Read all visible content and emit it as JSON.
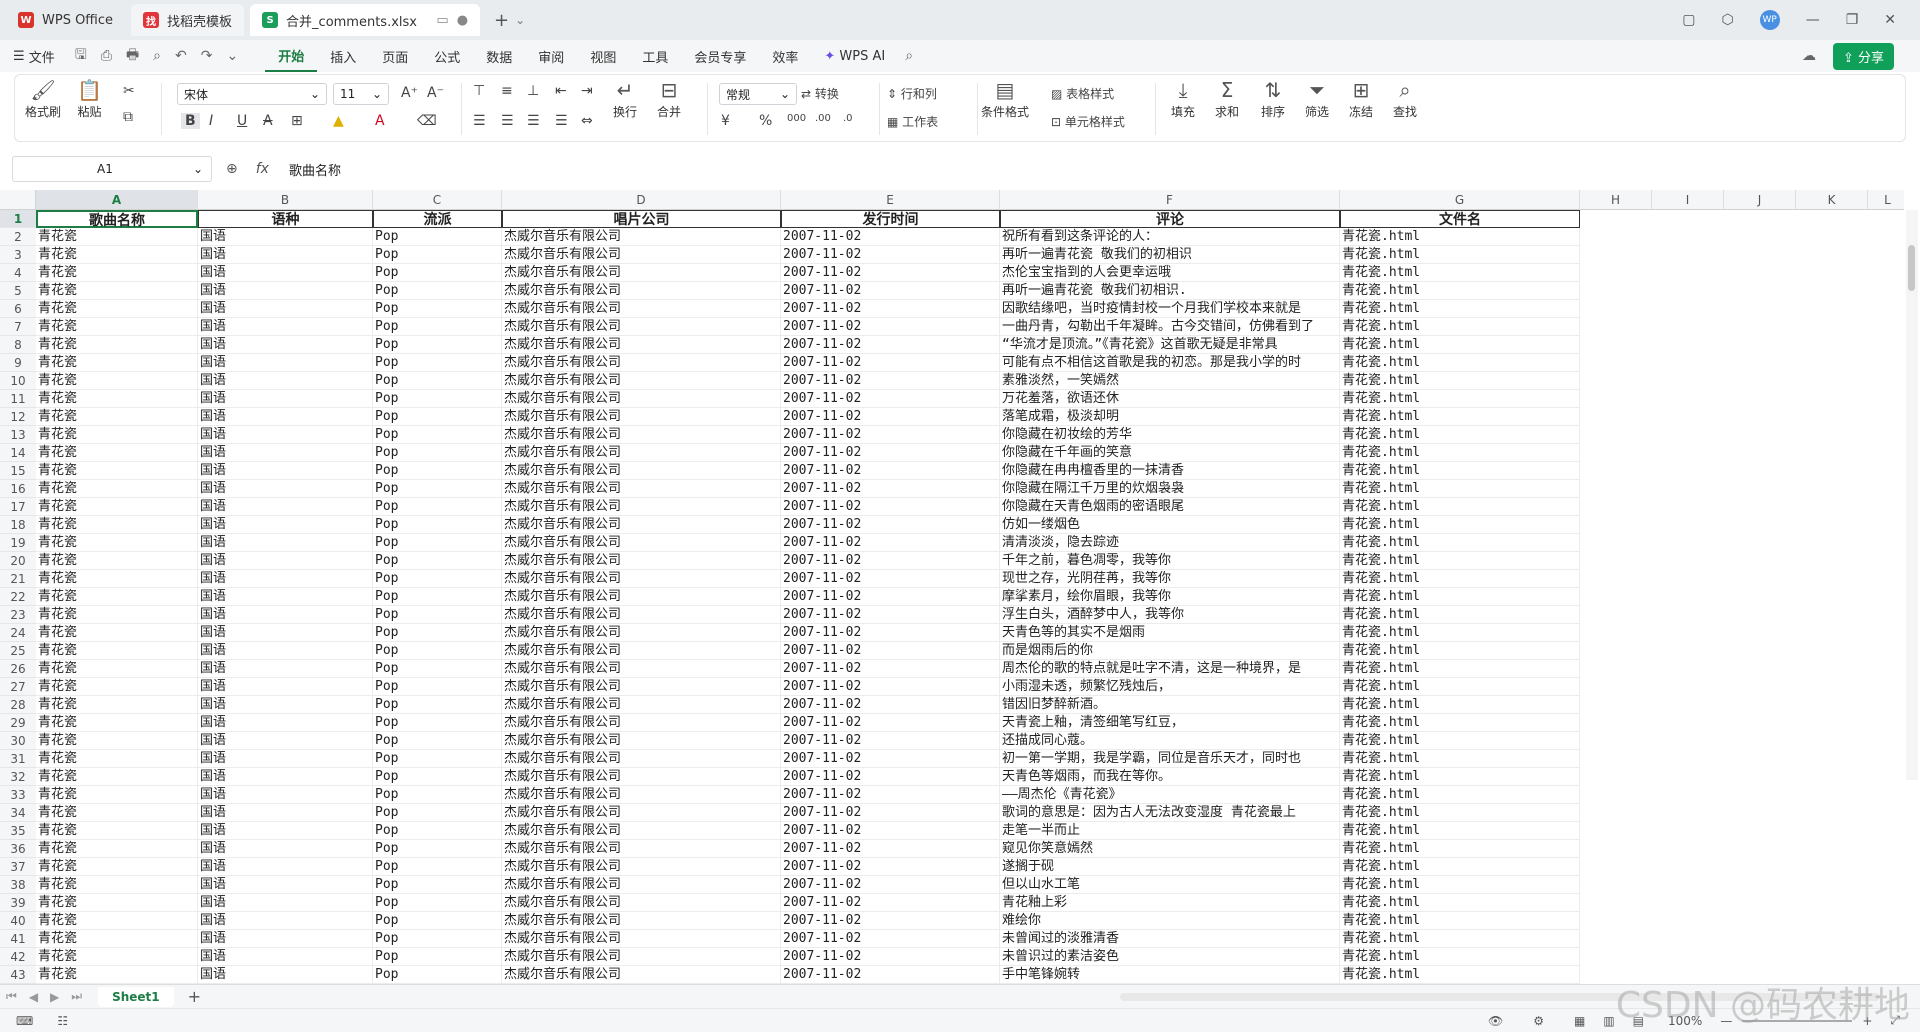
{
  "window": {
    "tabs": [
      {
        "label": "WPS Office",
        "icon": "wps-logo"
      },
      {
        "label": "找稻壳模板",
        "icon": "template-icon"
      },
      {
        "label": "合并_comments.xlsx",
        "icon": "sheet-icon"
      }
    ],
    "new_tab_label": "+",
    "avatar_text": "WP"
  },
  "menu": {
    "file_label": "文件",
    "items": [
      "开始",
      "插入",
      "页面",
      "公式",
      "数据",
      "审阅",
      "视图",
      "工具",
      "会员专享",
      "效率"
    ],
    "ai_label": "WPS AI",
    "share_label": "分享"
  },
  "ribbon": {
    "format_painter": "格式刷",
    "paste": "粘贴",
    "font_name": "宋体",
    "font_size": "11",
    "wrap": "换行",
    "merge": "合并",
    "number_format": "常规",
    "convert": "转换",
    "row_col": "行和列",
    "worksheet": "工作表",
    "cond_format": "条件格式",
    "table_style": "表格样式",
    "cell_style": "单元格样式",
    "fill": "填充",
    "sum": "求和",
    "sort": "排序",
    "filter": "筛选",
    "freeze": "冻结",
    "find": "查找"
  },
  "formula": {
    "cell_ref": "A1",
    "fx": "fx",
    "content": "歌曲名称"
  },
  "sheet": {
    "columns": [
      "A",
      "B",
      "C",
      "D",
      "E",
      "F",
      "G",
      "H",
      "I",
      "J",
      "K",
      "L"
    ],
    "headers": [
      "歌曲名称",
      "语种",
      "流派",
      "唱片公司",
      "发行时间",
      "评论",
      "文件名"
    ],
    "song": "青花瓷",
    "lang": "国语",
    "genre": "Pop",
    "company": "杰威尔音乐有限公司",
    "date": "2007-11-02",
    "file": "青花瓷.html",
    "comments": [
      "祝所有看到这条评论的人：",
      "再听一遍青花瓷 敬我们的初相识",
      "杰伦宝宝指到的人会更幸运哦",
      "再听一遍青花瓷 敬我们初相识.",
      "因歌结缘吧，当时疫情封校一个月我们学校本来就是",
      "一曲丹青，勾勒出千年凝眸。古今交错间，仿佛看到了",
      "“华流才是顶流。”《青花瓷》这首歌无疑是非常具",
      "可能有点不相信这首歌是我的初恋。那是我小学的时",
      "素雅淡然，一笑嫣然",
      "万花羞落，欲语还休",
      "落笔成霜，极淡却明",
      "你隐藏在初妆绘的芳华",
      "你隐藏在千年画的笑意",
      "你隐藏在冉冉檀香里的一抹清香",
      "你隐藏在隔江千万里的炊烟袅袅",
      "你隐藏在天青色烟雨的密语眼尾",
      "仿如一缕烟色",
      "清清淡淡，隐去踪迹",
      "千年之前，暮色凋零，我等你",
      "现世之存，光阴荏苒，我等你",
      "摩挲素月，绘你眉眼，我等你",
      "浮生白头，酒醉梦中人，我等你",
      "天青色等的其实不是烟雨",
      "而是烟雨后的你",
      "周杰伦的歌的特点就是吐字不清，这是一种境界，是",
      "小雨湿未透，频繁忆残烛后，",
      "错因旧梦醉新酒。",
      "天青瓷上釉，清签细笔写红豆，",
      "还描成同心蔻。",
      "初一第一学期，我是学霸，同位是音乐天才，同时也",
      "天青色等烟雨，而我在等你。",
      "——周杰伦《青花瓷》",
      "歌词的意思是：因为古人无法改变湿度 青花瓷最上",
      "走笔一半而止",
      "窥见你笑意嫣然",
      "遂搁于砚",
      "但以山水工笔",
      "青花釉上彩",
      "难绘你",
      "未曾闻过的淡雅清香",
      "未曾识过的素洁姿色",
      "手中笔锋婉转"
    ]
  },
  "sheet_tabs": {
    "active": "Sheet1",
    "add": "+"
  },
  "status": {
    "zoom": "100%"
  },
  "watermark": "CSDN @码农耕地"
}
